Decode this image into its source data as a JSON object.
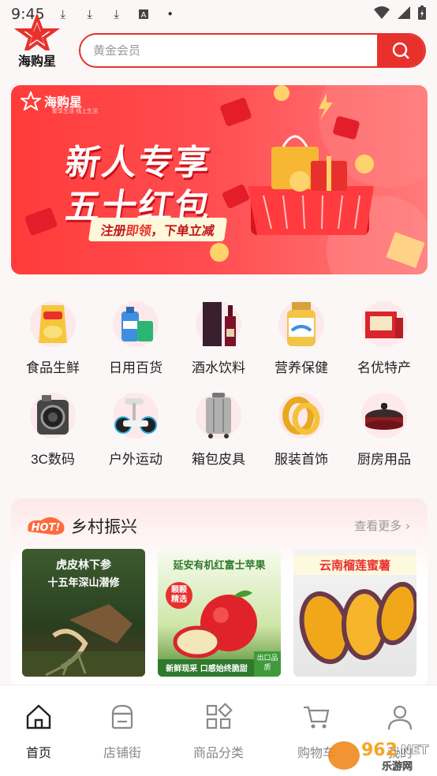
{
  "status": {
    "time": "9:45"
  },
  "header": {
    "logo_text": "海购星",
    "search_placeholder": "黄金会员"
  },
  "banner": {
    "brand": "海购星",
    "brand_sub": "聚享生活 线上生活",
    "line1": "新人专享",
    "line2": "五十红包",
    "tag_pre": "注册",
    "tag_hl": "即领",
    "tag_post": "，下单立减"
  },
  "categories": [
    {
      "label": "食品生鲜",
      "icon": "chips-icon"
    },
    {
      "label": "日用百货",
      "icon": "detergent-icon"
    },
    {
      "label": "酒水饮料",
      "icon": "wine-icon"
    },
    {
      "label": "营养保健",
      "icon": "supplement-icon"
    },
    {
      "label": "名优特产",
      "icon": "giftbox-icon"
    },
    {
      "label": "3C数码",
      "icon": "camera-icon"
    },
    {
      "label": "户外运动",
      "icon": "scooter-icon"
    },
    {
      "label": "箱包皮具",
      "icon": "luggage-icon"
    },
    {
      "label": "服装首饰",
      "icon": "ring-icon"
    },
    {
      "label": "厨房用品",
      "icon": "pan-icon"
    }
  ],
  "section": {
    "hot_badge": "HOT!",
    "title": "乡村振兴",
    "more": "查看更多",
    "cards": [
      {
        "title": "虎皮林下参",
        "subtitle": "十五年深山潜修"
      },
      {
        "title": "延安有机红富士苹果",
        "badge": "颗颗精选",
        "footer": "新鲜现采 口感始终脆甜",
        "corner": "出口品质"
      },
      {
        "title": "云南榴莲蜜薯"
      }
    ]
  },
  "tabs": [
    {
      "label": "首页",
      "icon": "home-icon"
    },
    {
      "label": "店铺街",
      "icon": "shop-icon"
    },
    {
      "label": "商品分类",
      "icon": "category-icon"
    },
    {
      "label": "购物车",
      "icon": "cart-icon"
    },
    {
      "label": "我的",
      "icon": "user-icon"
    }
  ],
  "watermark": {
    "text1": "962",
    "text2": ".NET",
    "text3": "乐游网"
  },
  "colors": {
    "accent": "#e8312d",
    "bg": "#fbf7f7"
  }
}
